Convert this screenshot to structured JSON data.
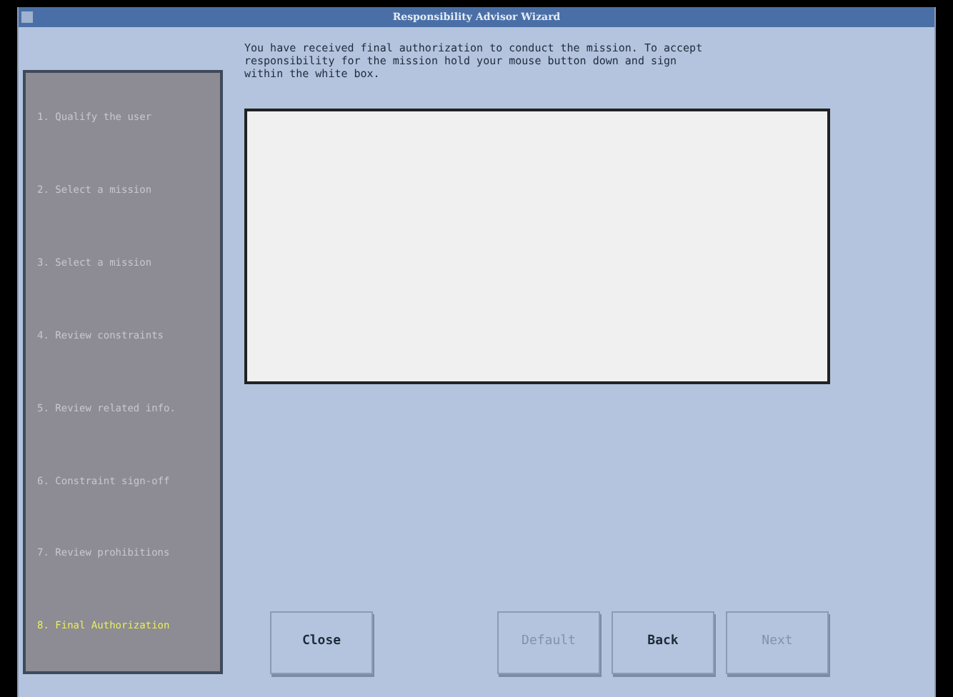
{
  "window": {
    "title": "Responsibility Advisor Wizard"
  },
  "steps": [
    {
      "label": "1. Qualify the user",
      "selected": false
    },
    {
      "label": "2. Select a mission",
      "selected": false
    },
    {
      "label": "3. Select a mission",
      "selected": false
    },
    {
      "label": "4. Review constraints",
      "selected": false
    },
    {
      "label": "5. Review related info.",
      "selected": false
    },
    {
      "label": "6. Constraint sign-off",
      "selected": false
    },
    {
      "label": "7. Review prohibitions",
      "selected": false
    },
    {
      "label": "8. Final Authorization",
      "selected": true
    }
  ],
  "instructions": "You have received final authorization to conduct the mission. To accept responsibility for the mission hold your mouse button down and sign within the white box.",
  "buttons": [
    {
      "label": "Close",
      "disabled": false
    },
    {
      "label": "Default",
      "disabled": true
    },
    {
      "label": "Back",
      "disabled": false
    },
    {
      "label": "Next",
      "disabled": true
    }
  ]
}
